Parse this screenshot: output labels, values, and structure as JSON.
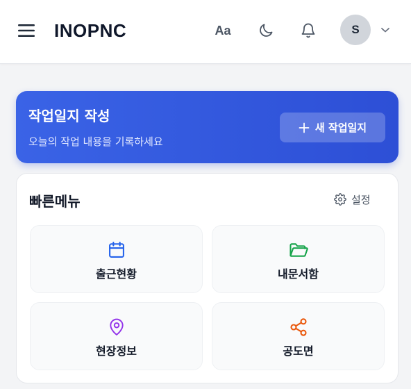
{
  "header": {
    "brand": "INOPNC",
    "font_size_label": "Aa",
    "avatar_initial": "S"
  },
  "hero": {
    "title": "작업일지 작성",
    "subtitle": "오늘의 작업 내용을 기록하세요",
    "button_label": "새 작업일지"
  },
  "quick_menu": {
    "title": "빠른메뉴",
    "settings_label": "설정",
    "items": [
      {
        "label": "출근현황",
        "icon": "calendar-icon",
        "color": "#2563eb"
      },
      {
        "label": "내문서함",
        "icon": "folder-open-icon",
        "color": "#16a34a"
      },
      {
        "label": "현장정보",
        "icon": "map-pin-icon",
        "color": "#9333ea"
      },
      {
        "label": "공도면",
        "icon": "share-icon",
        "color": "#ea580c"
      }
    ]
  },
  "colors": {
    "hero_gradient_start": "#3a63e6",
    "hero_gradient_end": "#2d4fd6",
    "page_background": "#f3f4f6"
  }
}
